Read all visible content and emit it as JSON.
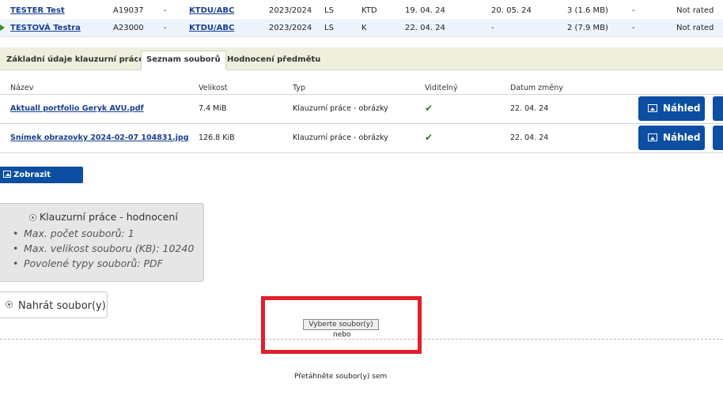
{
  "students": [
    {
      "name": "TESTER Test",
      "id": "A19037",
      "dash": "-",
      "subject": "KTDU/ABC",
      "year": "2023/2024",
      "sem": "LS",
      "type": "KTD",
      "date1": "19. 04. 24",
      "date2": "20. 05. 24",
      "files": "3 (1.6 MB)",
      "dash2": "-",
      "rating": "Not rated"
    },
    {
      "name": "TESTOVÁ Testra",
      "id": "A23000",
      "dash": "-",
      "subject": "KTDU/ABC",
      "year": "2023/2024",
      "sem": "LS",
      "type": "K",
      "date1": "22. 04. 24",
      "date2": "-",
      "files": "2 (7.9 MB)",
      "dash2": "-",
      "rating": "Not rated"
    }
  ],
  "tabs": [
    "Základní údaje klauzurní práce",
    "Seznam souborů",
    "Hodnocení předmětu"
  ],
  "file_table": {
    "headers": [
      "Název",
      "Velikost",
      "Typ",
      "Viditelný",
      "Datum změny"
    ],
    "rows": [
      {
        "name": "Aktuall portfolio Geryk AVU.pdf",
        "size": "7.4 MiB",
        "type": "Klauzurní práce - obrázky",
        "visible": "✔",
        "date": "22. 04. 24",
        "preview": "Náhled"
      },
      {
        "name": "Snímek obrazovky 2024-02-07 104831.jpg",
        "size": "126.8 KiB",
        "type": "Klauzurní práce - obrázky",
        "visible": "✔",
        "date": "22. 04. 24",
        "preview": "Náhled"
      }
    ]
  },
  "show_images_label": "Zobrazit obrázky",
  "info": {
    "title": "Klauzurní práce - hodnocení",
    "items": [
      "Max. počet souborů: 1",
      "Max. velikost souboru (KB): 10240",
      "Povolené typy souborů: PDF"
    ]
  },
  "upload_label": "Nahrát soubor(y)",
  "choose_label": "Vyberte soubor(y)",
  "or_label": "nebo",
  "drop_label": "Přetáhněte soubor(y) sem",
  "colors": {
    "accent": "#0b4ea2",
    "highlight": "#e0202a"
  }
}
